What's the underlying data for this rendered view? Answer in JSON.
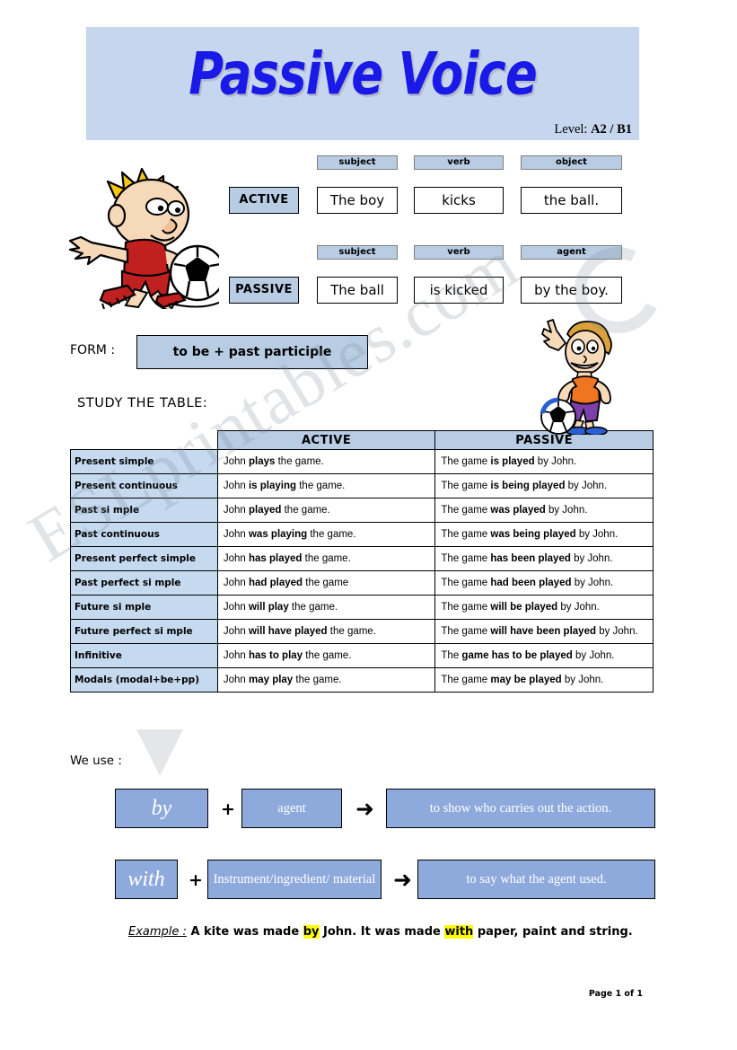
{
  "header": {
    "title": "Passive Voice",
    "level_prefix": "Level: ",
    "level_value": "A2 / B1"
  },
  "diagram": {
    "active_row": {
      "voice": "ACTIVE",
      "labels": [
        "subject",
        "verb",
        "object"
      ],
      "cells": [
        "The boy",
        "kicks",
        "the ball."
      ]
    },
    "passive_row": {
      "voice": "PASSIVE",
      "labels": [
        "subject",
        "verb",
        "agent"
      ],
      "cells": [
        "The ball",
        "is kicked",
        "by the boy."
      ]
    }
  },
  "form": {
    "label": "FORM :",
    "value": "to be + past participle"
  },
  "study": {
    "label": "STUDY  THE  TABLE:"
  },
  "table": {
    "headers": [
      "",
      "ACTIVE",
      "PASSIVE"
    ],
    "rows": [
      {
        "tense": "Present simple",
        "active": [
          {
            "t": "John ",
            "b": false
          },
          {
            "t": "plays",
            "b": true
          },
          {
            "t": " the game.",
            "b": false
          }
        ],
        "passive": [
          {
            "t": "The game ",
            "b": false
          },
          {
            "t": "is played",
            "b": true
          },
          {
            "t": " by John.",
            "b": false
          }
        ]
      },
      {
        "tense": "Present continuous",
        "active": [
          {
            "t": "John ",
            "b": false
          },
          {
            "t": "is playing",
            "b": true
          },
          {
            "t": " the game.",
            "b": false
          }
        ],
        "passive": [
          {
            "t": "The game ",
            "b": false
          },
          {
            "t": "is being played",
            "b": true
          },
          {
            "t": " by John.",
            "b": false
          }
        ]
      },
      {
        "tense": "Past si mple",
        "active": [
          {
            "t": "John ",
            "b": false
          },
          {
            "t": "played",
            "b": true
          },
          {
            "t": " the game.",
            "b": false
          }
        ],
        "passive": [
          {
            "t": "The game ",
            "b": false
          },
          {
            "t": "was played",
            "b": true
          },
          {
            "t": " by John.",
            "b": false
          }
        ]
      },
      {
        "tense": "Past continuous",
        "active": [
          {
            "t": "John ",
            "b": false
          },
          {
            "t": "was playing",
            "b": true
          },
          {
            "t": " the game.",
            "b": false
          }
        ],
        "passive": [
          {
            "t": "The game ",
            "b": false
          },
          {
            "t": "was being played",
            "b": true
          },
          {
            "t": " by John.",
            "b": false
          }
        ]
      },
      {
        "tense": "Present perfect simple",
        "active": [
          {
            "t": "John ",
            "b": false
          },
          {
            "t": "has played",
            "b": true
          },
          {
            "t": " the game.",
            "b": false
          }
        ],
        "passive": [
          {
            "t": "The game ",
            "b": false
          },
          {
            "t": "has been played",
            "b": true
          },
          {
            "t": " by John.",
            "b": false
          }
        ]
      },
      {
        "tense": "Past perfect si mple",
        "active": [
          {
            "t": "John ",
            "b": false
          },
          {
            "t": "had played",
            "b": true
          },
          {
            "t": " the game",
            "b": false
          }
        ],
        "passive": [
          {
            "t": "The game ",
            "b": false
          },
          {
            "t": "had been played",
            "b": true
          },
          {
            "t": " by John.",
            "b": false
          }
        ]
      },
      {
        "tense": "Future si mple",
        "active": [
          {
            "t": "John ",
            "b": false
          },
          {
            "t": "will play",
            "b": true
          },
          {
            "t": " the game.",
            "b": false
          }
        ],
        "passive": [
          {
            "t": "The game ",
            "b": false
          },
          {
            "t": "will be played",
            "b": true
          },
          {
            "t": " by John.",
            "b": false
          }
        ]
      },
      {
        "tense": "Future perfect si mple",
        "active": [
          {
            "t": "John ",
            "b": false
          },
          {
            "t": "will have played",
            "b": true
          },
          {
            "t": " the game.",
            "b": false
          }
        ],
        "passive": [
          {
            "t": "The game ",
            "b": false
          },
          {
            "t": "will have been played",
            "b": true
          },
          {
            "t": " by John.",
            "b": false
          }
        ]
      },
      {
        "tense": "Infinitive",
        "active": [
          {
            "t": "John ",
            "b": false
          },
          {
            "t": "has to play",
            "b": true
          },
          {
            "t": " the game.",
            "b": false
          }
        ],
        "passive": [
          {
            "t": "The ",
            "b": false
          },
          {
            "t": "game has to be played",
            "b": true
          },
          {
            "t": " by John.",
            "b": false
          }
        ]
      },
      {
        "tense": "Modals (modal+be+pp)",
        "active": [
          {
            "t": "John ",
            "b": false
          },
          {
            "t": "may play",
            "b": true
          },
          {
            "t": " the game.",
            "b": false
          }
        ],
        "passive": [
          {
            "t": "The game ",
            "b": false
          },
          {
            "t": "may be played",
            "b": true
          },
          {
            "t": " by John.",
            "b": false
          }
        ]
      }
    ]
  },
  "weuse": {
    "label": "We use :",
    "rule1": {
      "prep": "by",
      "plus": "+",
      "middle": "agent",
      "arrow": "➜",
      "result": "to show who carries out the action."
    },
    "rule2": {
      "prep": "with",
      "plus": "+",
      "middle": "Instrument/ingredient/ material",
      "arrow": "➜",
      "result": "to say what the agent used."
    }
  },
  "example": {
    "label": "Example :",
    "part1": " A kite was made ",
    "hl1": "by",
    "part2": " John. It was made ",
    "hl2": "with",
    "part3": " paper, paint and string."
  },
  "footer": {
    "page": "Page 1 of 1"
  },
  "watermark": {
    "text": "ESLprintables.com"
  },
  "colors": {
    "banner_bg": "#c6d6ee",
    "title_blue": "#1a1ae8",
    "label_blue": "#b8cce4",
    "row_blue": "#c5d9ef",
    "box_blue": "#8eaadc",
    "highlight": "#ffff00"
  }
}
